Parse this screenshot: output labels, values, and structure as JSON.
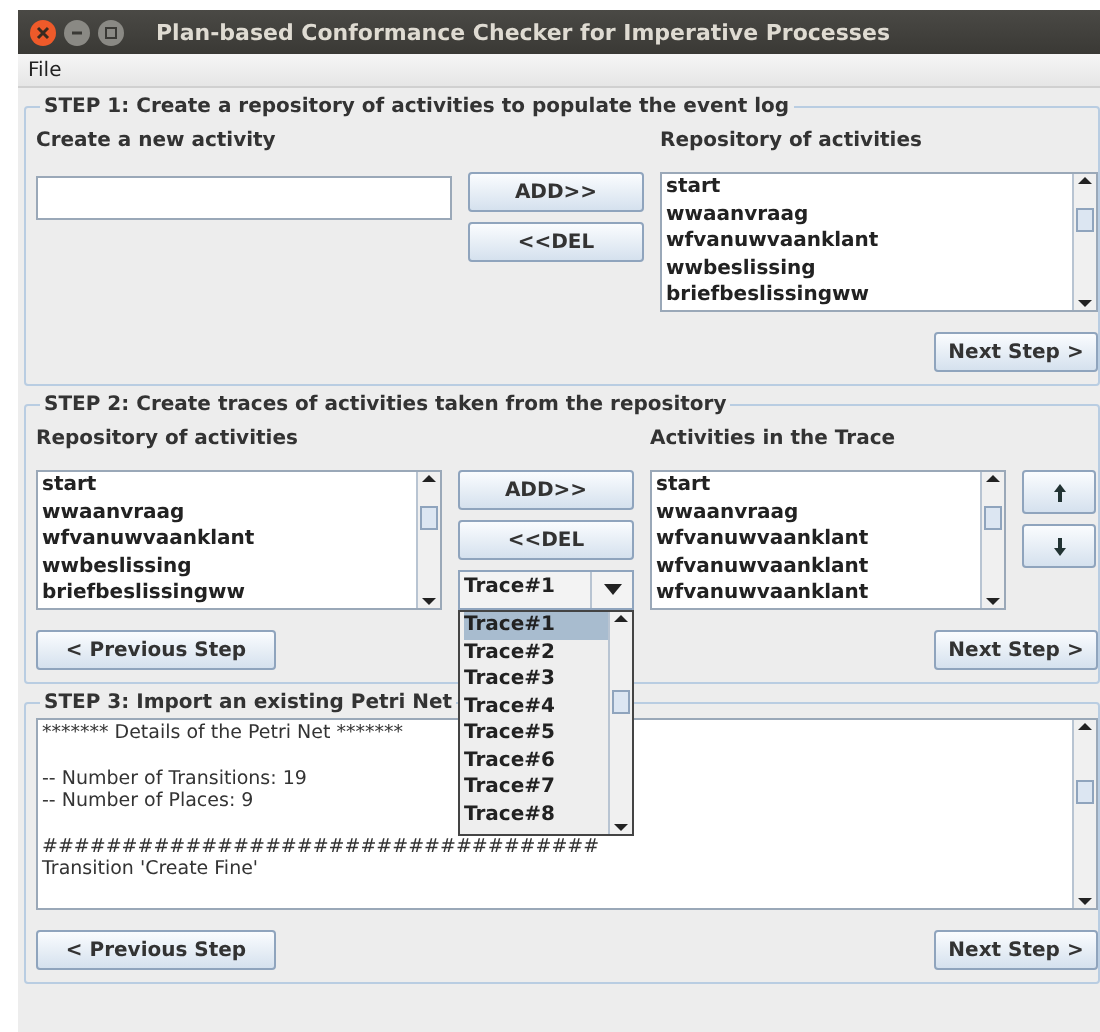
{
  "window": {
    "title": "Plan-based Conformance Checker for Imperative Processes"
  },
  "menu": [
    "File"
  ],
  "step1": {
    "legend": "STEP 1: Create a repository of activities to populate the event log",
    "new_label": "Create a new activity",
    "repo_label": "Repository of activities",
    "buttons": [
      "ADD>>",
      "<<DEL"
    ],
    "repository": [
      "start",
      "wwaanvraag",
      "wfvanuwvaanklant",
      "wwbeslissing",
      "briefbeslissingww"
    ],
    "next": "Next Step >"
  },
  "step2": {
    "legend": "STEP 2: Create traces of activities taken from the repository",
    "repo_label": "Repository of activities",
    "repository": [
      "start",
      "wwaanvraag",
      "wfvanuwvaanklant",
      "wwbeslissing",
      "briefbeslissingww"
    ],
    "buttons": [
      "ADD>>",
      "<<DEL"
    ],
    "trace_combo": {
      "value": "Trace#1",
      "expanded": true,
      "options": [
        {
          "label": "Trace#1",
          "selected": true
        },
        {
          "label": "Trace#2",
          "selected": false
        },
        {
          "label": "Trace#3",
          "selected": false
        },
        {
          "label": "Trace#4",
          "selected": false
        },
        {
          "label": "Trace#5",
          "selected": false
        },
        {
          "label": "Trace#6",
          "selected": false
        },
        {
          "label": "Trace#7",
          "selected": false
        },
        {
          "label": "Trace#8",
          "selected": false
        }
      ]
    },
    "trace_label": "Activities in the Trace",
    "trace": [
      "start",
      "wwaanvraag",
      "wfvanuwvaanklant",
      "wfvanuwvaanklant",
      "wfvanuwvaanklant"
    ],
    "previous": "< Previous Step",
    "next": "Next Step >"
  },
  "step3": {
    "legend": "STEP 3: Import an existing Petri Net",
    "details": [
      [
        "******* Details of the Petri Net *******"
      ],
      [
        "-- Number of Transitions: 19",
        "-- Number of Places: 9"
      ],
      [
        "###################################",
        "Transition 'Create Fine'"
      ]
    ],
    "previous": "< Previous Step",
    "next": "Next Step >"
  }
}
